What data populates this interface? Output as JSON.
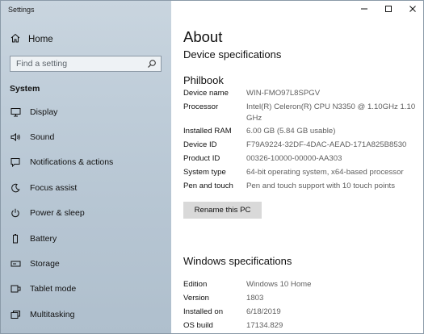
{
  "window": {
    "title": "Settings"
  },
  "sidebar": {
    "home_label": "Home",
    "search_placeholder": "Find a setting",
    "section_label": "System",
    "items": [
      {
        "label": "Display",
        "icon": "display-icon"
      },
      {
        "label": "Sound",
        "icon": "sound-icon"
      },
      {
        "label": "Notifications & actions",
        "icon": "notifications-icon"
      },
      {
        "label": "Focus assist",
        "icon": "focus-assist-icon"
      },
      {
        "label": "Power & sleep",
        "icon": "power-icon"
      },
      {
        "label": "Battery",
        "icon": "battery-icon"
      },
      {
        "label": "Storage",
        "icon": "storage-icon"
      },
      {
        "label": "Tablet mode",
        "icon": "tablet-mode-icon"
      },
      {
        "label": "Multitasking",
        "icon": "multitasking-icon"
      }
    ]
  },
  "main": {
    "title": "About",
    "subtitle": "Device specifications",
    "device_heading": "Philbook",
    "device_specs": [
      {
        "label": "Device name",
        "value": "WIN-FMO97L8SPGV"
      },
      {
        "label": "Processor",
        "value": "Intel(R) Celeron(R) CPU N3350 @ 1.10GHz   1.10 GHz"
      },
      {
        "label": "Installed RAM",
        "value": "6.00 GB (5.84 GB usable)"
      },
      {
        "label": "Device ID",
        "value": "F79A9224-32DF-4DAC-AEAD-171A825B8530"
      },
      {
        "label": "Product ID",
        "value": "00326-10000-00000-AA303"
      },
      {
        "label": "System type",
        "value": "64-bit operating system, x64-based processor"
      },
      {
        "label": "Pen and touch",
        "value": "Pen and touch support with 10 touch points"
      }
    ],
    "rename_button": "Rename this PC",
    "windows_heading": "Windows specifications",
    "windows_specs": [
      {
        "label": "Edition",
        "value": "Windows 10 Home"
      },
      {
        "label": "Version",
        "value": "1803"
      },
      {
        "label": "Installed on",
        "value": "6/18/2019"
      },
      {
        "label": "OS build",
        "value": "17134.829"
      }
    ]
  }
}
